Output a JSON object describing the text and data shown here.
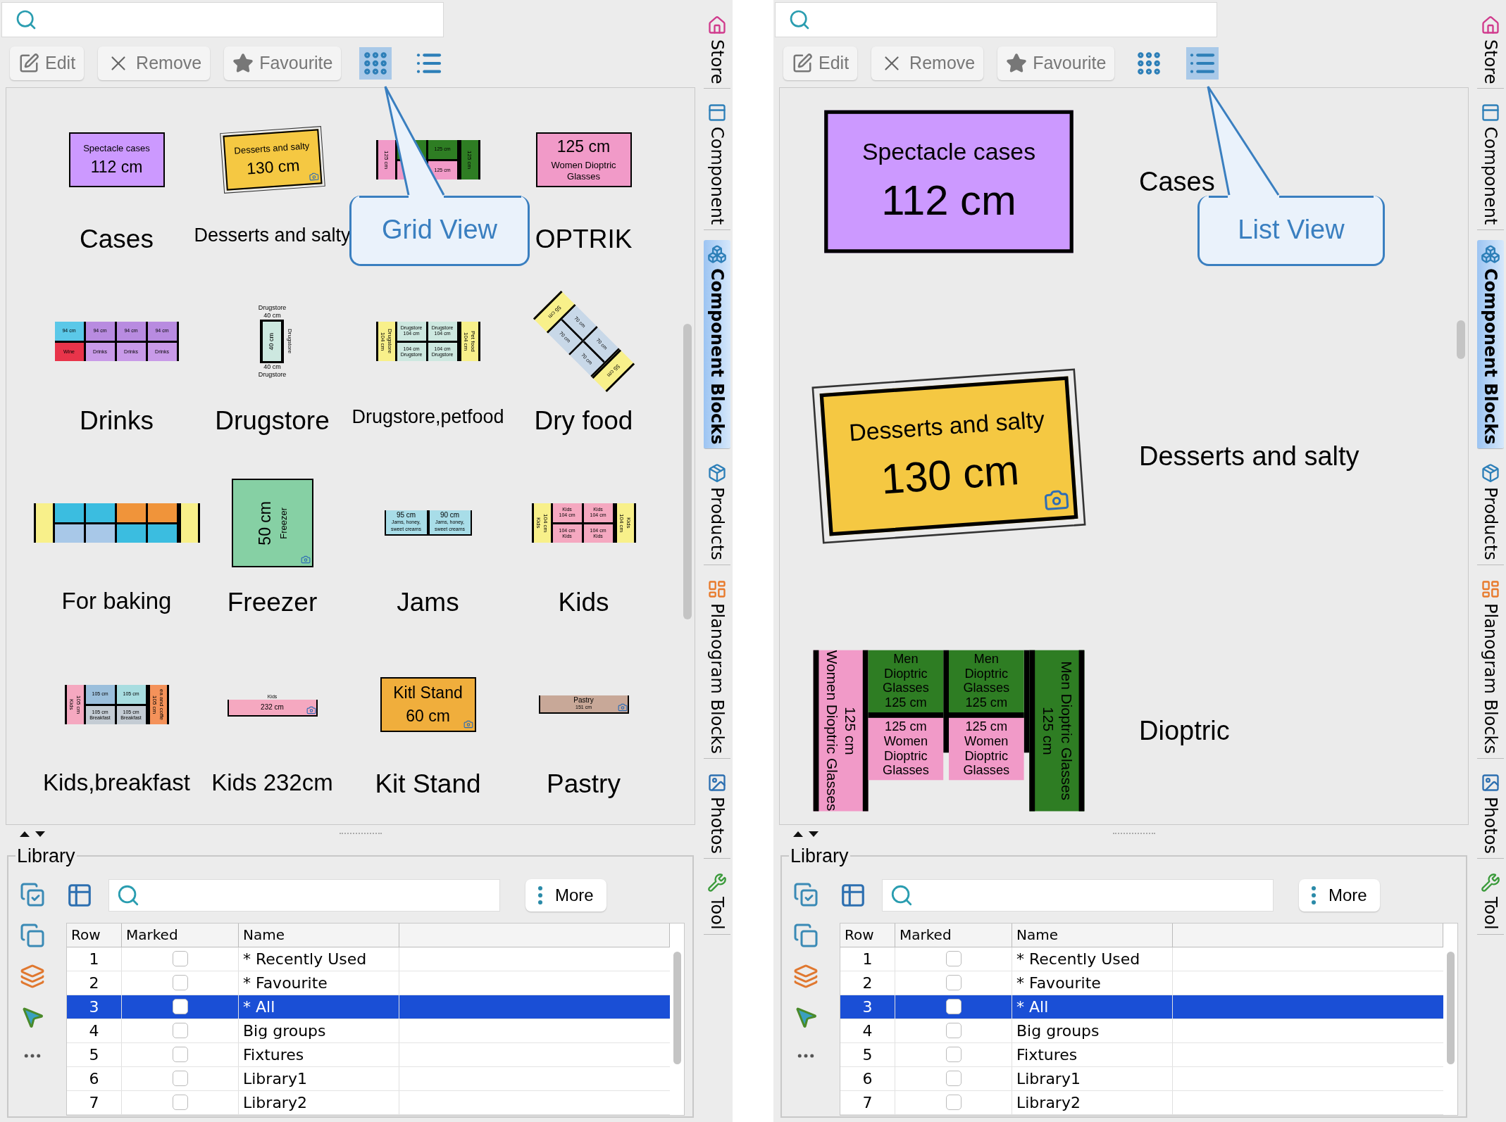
{
  "panels": [
    {
      "toolbar": [
        {
          "kind": "edit",
          "label": "Edit"
        },
        {
          "kind": "remove",
          "label": "Remove"
        },
        {
          "kind": "favourite",
          "label": "Favourite"
        }
      ],
      "view_buttons": [
        {
          "kind": "grid",
          "selected": true
        },
        {
          "kind": "list",
          "selected": false
        }
      ],
      "callout": "Grid View",
      "items": [
        {
          "name": "Cases",
          "thumb": {
            "kind": "sign",
            "color": "#cc99ff",
            "lines": [
              {
                "kind": "name",
                "text": "Spectacle cases"
              },
              {
                "kind": "size",
                "text": "112 cm"
              }
            ]
          }
        },
        {
          "name": "Desserts and salty",
          "thumb": {
            "kind": "sign",
            "color": "#f5c842",
            "tilt": true,
            "camera": true,
            "lines": [
              {
                "kind": "name",
                "text": "Desserts and salty"
              },
              {
                "kind": "size",
                "text": "130 cm"
              }
            ]
          }
        },
        {
          "thumb": {
            "kind": "bays",
            "bays": [
              {
                "kind": "end",
                "color": "#f19ac8",
                "texts": [
                  "125 cm"
                ]
              },
              {
                "kind": "bay",
                "halves": [
                  {
                    "color": "#2e7d23"
                  },
                  {
                    "color": "#f19ac8"
                  }
                ]
              },
              {
                "kind": "bay",
                "halves": [
                  {
                    "color": "#2e7d23",
                    "texts": [
                      "125 cm"
                    ]
                  },
                  {
                    "color": "#f19ac8",
                    "texts": [
                      "125 cm"
                    ]
                  }
                ]
              },
              {
                "kind": "end",
                "color": "#2e7d23",
                "texts": [
                  "125 cm"
                ]
              }
            ]
          }
        },
        {
          "name": "OPTRIK",
          "thumb": {
            "kind": "sign",
            "color": "#f19ac8",
            "lines": [
              {
                "kind": "size",
                "text": "125 cm"
              },
              {
                "kind": "name",
                "text": "Women Dioptric Glasses"
              }
            ]
          }
        },
        {
          "name": "Drinks",
          "thumb": {
            "kind": "bays",
            "bays": [
              {
                "kind": "bay",
                "halves": [
                  {
                    "color": "#5bc8e8",
                    "texts": [
                      "94 cm"
                    ]
                  },
                  {
                    "color": "#e8344a",
                    "texts": [
                      "Wine"
                    ]
                  }
                ]
              },
              {
                "kind": "bay",
                "halves": [
                  {
                    "color": "#b88be0",
                    "texts": [
                      "94 cm"
                    ]
                  },
                  {
                    "color": "#c89ae8",
                    "texts": [
                      "Drinks"
                    ]
                  }
                ]
              },
              {
                "kind": "bay",
                "halves": [
                  {
                    "color": "#b88be0",
                    "texts": [
                      "94 cm"
                    ]
                  },
                  {
                    "color": "#c89ae8",
                    "texts": [
                      "Drinks"
                    ]
                  }
                ]
              },
              {
                "kind": "bay",
                "halves": [
                  {
                    "color": "#b88be0",
                    "texts": [
                      "94 cm"
                    ]
                  },
                  {
                    "color": "#c89ae8",
                    "texts": [
                      "Drinks"
                    ]
                  }
                ]
              }
            ]
          }
        },
        {
          "name": "Drugstore",
          "thumb": {
            "kind": "stand",
            "top": [
              "Drugstore",
              "40 cm"
            ],
            "bay": {
              "color": "#cde8e0",
              "texts": [
                "40 cm"
              ]
            },
            "side": "Drugstore",
            "bottom": [
              "40 cm",
              "Drugstore"
            ]
          }
        },
        {
          "name": "Drugstore,petfood",
          "thumb": {
            "kind": "bays",
            "bays": [
              {
                "kind": "end",
                "color": "#f8f08a",
                "texts": [
                  "104 cm",
                  "Drugstore"
                ]
              },
              {
                "kind": "bay",
                "halves": [
                  {
                    "color": "#cde8e0",
                    "texts": [
                      "Drugstore",
                      "104 cm"
                    ]
                  },
                  {
                    "color": "#cde8e0",
                    "texts": [
                      "104 cm",
                      "Drugstore"
                    ]
                  }
                ]
              },
              {
                "kind": "bay",
                "halves": [
                  {
                    "color": "#cde8e0",
                    "texts": [
                      "Drugstore",
                      "104 cm"
                    ]
                  },
                  {
                    "color": "#cde8e0",
                    "texts": [
                      "104 cm",
                      "Drugstore"
                    ]
                  }
                ]
              },
              {
                "kind": "end",
                "color": "#f8f08a",
                "texts": [
                  "104 cm",
                  "Pet food"
                ]
              }
            ]
          }
        },
        {
          "name": "Dry food",
          "thumb": {
            "kind": "diagonal",
            "bays": [
              {
                "kind": "end",
                "color": "#f8f08a",
                "texts": [
                  "55 cm"
                ]
              },
              {
                "kind": "bay",
                "halves": [
                  {
                    "color": "#c8d8e8",
                    "texts": [
                      "70 cm"
                    ]
                  },
                  {
                    "color": "#c8d8e8",
                    "texts": [
                      "70 cm"
                    ]
                  }
                ]
              },
              {
                "kind": "bay",
                "halves": [
                  {
                    "color": "#c8d8e8",
                    "texts": [
                      "70 cm"
                    ]
                  },
                  {
                    "color": "#c8d8e8",
                    "texts": [
                      "70 cm"
                    ]
                  }
                ]
              },
              {
                "kind": "end",
                "color": "#f8f08a",
                "texts": [
                  "55 cm"
                ]
              }
            ]
          }
        },
        {
          "name": "For baking",
          "thumb": {
            "kind": "bays",
            "bays": [
              {
                "kind": "end",
                "color": "#f8f08a"
              },
              {
                "kind": "bay",
                "halves": [
                  {
                    "color": "#3bbde0"
                  },
                  {
                    "color": "#a8c8e8"
                  }
                ]
              },
              {
                "kind": "bay",
                "halves": [
                  {
                    "color": "#3bbde0"
                  },
                  {
                    "color": "#a8c8e8"
                  }
                ]
              },
              {
                "kind": "bay",
                "halves": [
                  {
                    "color": "#f0943a"
                  },
                  {
                    "color": "#3bbde0"
                  }
                ]
              },
              {
                "kind": "bay",
                "halves": [
                  {
                    "color": "#f0943a"
                  },
                  {
                    "color": "#3bbde0"
                  }
                ]
              },
              {
                "kind": "end",
                "color": "#f8f08a"
              }
            ]
          }
        },
        {
          "name": "Freezer",
          "thumb": {
            "kind": "sign",
            "color": "#86d0a4",
            "vertical": true,
            "camera": true,
            "lines": [
              {
                "kind": "size",
                "text": "50 cm"
              },
              {
                "kind": "name",
                "text": "Freezer"
              }
            ]
          }
        },
        {
          "name": "Jams",
          "thumb": {
            "kind": "bays",
            "bays": [
              {
                "kind": "bay",
                "color": "#a8dde8",
                "texts": [
                  "95 cm",
                  "Jams, honey, sweet creams"
                ]
              },
              {
                "kind": "bay",
                "color": "#a8dde8",
                "texts": [
                  "90 cm",
                  "Jams, honey, sweet creams"
                ]
              }
            ]
          }
        },
        {
          "name": "Kids",
          "thumb": {
            "kind": "bays",
            "bays": [
              {
                "kind": "end",
                "color": "#f8f08a",
                "texts": [
                  "Kids",
                  "104 cm"
                ]
              },
              {
                "kind": "bay",
                "halves": [
                  {
                    "color": "#f5a8c0",
                    "texts": [
                      "Kids",
                      "104 cm"
                    ]
                  },
                  {
                    "color": "#f5a8c0",
                    "texts": [
                      "104 cm",
                      "Kids"
                    ]
                  }
                ]
              },
              {
                "kind": "bay",
                "halves": [
                  {
                    "color": "#f5a8c0",
                    "texts": [
                      "Kids",
                      "104 cm"
                    ]
                  },
                  {
                    "color": "#f5a8c0",
                    "texts": [
                      "104 cm",
                      "Kids"
                    ]
                  }
                ]
              },
              {
                "kind": "end",
                "color": "#f8f08a",
                "texts": [
                  "104 cm",
                  "Kids"
                ]
              }
            ]
          }
        },
        {
          "name": "Kids,breakfast",
          "thumb": {
            "kind": "bays",
            "bays": [
              {
                "kind": "end",
                "color": "#f5a8c0",
                "texts": [
                  "Kids",
                  "105 cm"
                ]
              },
              {
                "kind": "bay",
                "halves": [
                  {
                    "color": "#9bbfdc",
                    "texts": [
                      "105 cm"
                    ]
                  },
                  {
                    "color": "#c4ccd4",
                    "texts": [
                      "105 cm",
                      "Breakfast"
                    ]
                  }
                ]
              },
              {
                "kind": "bay",
                "halves": [
                  {
                    "color": "#a8dde0",
                    "texts": [
                      "105 cm"
                    ]
                  },
                  {
                    "color": "#c4ccd4",
                    "texts": [
                      "105 cm",
                      "Breakfast"
                    ]
                  }
                ]
              },
              {
                "kind": "end",
                "color": "#f4925a",
                "texts": [
                  "105 cm",
                  "ea and coffe"
                ]
              }
            ]
          }
        },
        {
          "name": "Kids 232cm",
          "thumb": {
            "kind": "bays",
            "caption": "Kids",
            "camera": true,
            "bays": [
              {
                "kind": "bay",
                "color": "#f5a8c0",
                "texts": [
                  "232 cm"
                ]
              }
            ]
          }
        },
        {
          "name": "Kit Stand",
          "thumb": {
            "kind": "sign",
            "color": "#f0ae3c",
            "camera": true,
            "lines": [
              {
                "kind": "size",
                "text": "Kitl Stand"
              },
              {
                "kind": "size",
                "text": "60 cm"
              }
            ]
          }
        },
        {
          "name": "Pastry",
          "thumb": {
            "kind": "bays",
            "camera": true,
            "bays": [
              {
                "kind": "bay",
                "color": "#c8a898",
                "texts": [
                  "Pastry",
                  "151 cm"
                ]
              }
            ]
          }
        }
      ],
      "library": {
        "legend": "Library",
        "more": "More",
        "columns": [
          "Row",
          "Marked",
          "Name"
        ],
        "rows": [
          {
            "row": "1",
            "marked": false,
            "name": "* Recently Used",
            "selected": false
          },
          {
            "row": "2",
            "marked": false,
            "name": "* Favourite",
            "selected": false
          },
          {
            "row": "3",
            "marked": false,
            "name": "* All",
            "selected": true
          },
          {
            "row": "4",
            "marked": false,
            "name": "Big groups",
            "selected": false
          },
          {
            "row": "5",
            "marked": false,
            "name": "Fixtures",
            "selected": false
          },
          {
            "row": "6",
            "marked": false,
            "name": "Library1",
            "selected": false
          },
          {
            "row": "7",
            "marked": false,
            "name": "Library2",
            "selected": false
          }
        ]
      },
      "side_tabs": [
        {
          "kind": "store",
          "label": "Store",
          "selected": false
        },
        {
          "kind": "component",
          "label": "Component",
          "selected": false
        },
        {
          "kind": "blocks",
          "label": "Component Blocks",
          "selected": true
        },
        {
          "kind": "products",
          "label": "Products",
          "selected": false
        },
        {
          "kind": "planogram",
          "label": "Planogram Blocks",
          "selected": false
        },
        {
          "kind": "photos",
          "label": "Photos",
          "selected": false
        },
        {
          "kind": "tool",
          "label": "Tool",
          "selected": false
        }
      ]
    },
    {
      "toolbar": [
        {
          "kind": "edit",
          "label": "Edit"
        },
        {
          "kind": "remove",
          "label": "Remove"
        },
        {
          "kind": "favourite",
          "label": "Favourite"
        }
      ],
      "view_buttons": [
        {
          "kind": "grid",
          "selected": false
        },
        {
          "kind": "list",
          "selected": true
        }
      ],
      "callout": "List View",
      "items": [
        {
          "name": "Cases",
          "thumb": {
            "kind": "sign",
            "color": "#cc99ff",
            "lines": [
              {
                "kind": "name",
                "text": "Spectacle cases"
              },
              {
                "kind": "size",
                "text": "112 cm"
              }
            ]
          }
        },
        {
          "name": "Desserts and salty",
          "thumb": {
            "kind": "sign",
            "color": "#f5c842",
            "tilt": true,
            "camera": true,
            "lines": [
              {
                "kind": "name",
                "text": "Desserts and salty"
              },
              {
                "kind": "size",
                "text": "130 cm"
              }
            ]
          }
        },
        {
          "name": "Dioptric",
          "thumb": {
            "kind": "bays",
            "bays": [
              {
                "kind": "end",
                "color": "#f19ac8",
                "texts": [
                  "Women Dioptric Glasses",
                  "125 cm"
                ]
              },
              {
                "kind": "bay",
                "halves": [
                  {
                    "color": "#2e7d23",
                    "texts": [
                      "Men Dioptric Glasses",
                      "125 cm"
                    ]
                  },
                  {
                    "color": "#f19ac8",
                    "texts": [
                      "125 cm",
                      "Women Dioptric Glasses"
                    ]
                  }
                ]
              },
              {
                "kind": "bay",
                "halves": [
                  {
                    "color": "#2e7d23",
                    "texts": [
                      "Men Dioptric Glasses",
                      "125 cm"
                    ]
                  },
                  {
                    "color": "#f19ac8",
                    "texts": [
                      "125 cm",
                      "Women Dioptric Glasses"
                    ]
                  }
                ]
              },
              {
                "kind": "end",
                "color": "#2e7d23",
                "texts": [
                  "125 cm",
                  "Men Dioptric Glasses"
                ]
              }
            ]
          }
        }
      ],
      "library": {
        "legend": "Library",
        "more": "More",
        "columns": [
          "Row",
          "Marked",
          "Name"
        ],
        "rows": [
          {
            "row": "1",
            "marked": false,
            "name": "* Recently Used",
            "selected": false
          },
          {
            "row": "2",
            "marked": false,
            "name": "* Favourite",
            "selected": false
          },
          {
            "row": "3",
            "marked": false,
            "name": "* All",
            "selected": true
          },
          {
            "row": "4",
            "marked": false,
            "name": "Big groups",
            "selected": false
          },
          {
            "row": "5",
            "marked": false,
            "name": "Fixtures",
            "selected": false
          },
          {
            "row": "6",
            "marked": false,
            "name": "Library1",
            "selected": false
          },
          {
            "row": "7",
            "marked": false,
            "name": "Library2",
            "selected": false
          }
        ]
      },
      "side_tabs": [
        {
          "kind": "store",
          "label": "Store",
          "selected": false
        },
        {
          "kind": "component",
          "label": "Component",
          "selected": false
        },
        {
          "kind": "blocks",
          "label": "Component Blocks",
          "selected": true
        },
        {
          "kind": "products",
          "label": "Products",
          "selected": false
        },
        {
          "kind": "planogram",
          "label": "Planogram Blocks",
          "selected": false
        },
        {
          "kind": "photos",
          "label": "Photos",
          "selected": false
        },
        {
          "kind": "tool",
          "label": "Tool",
          "selected": false
        }
      ]
    }
  ]
}
